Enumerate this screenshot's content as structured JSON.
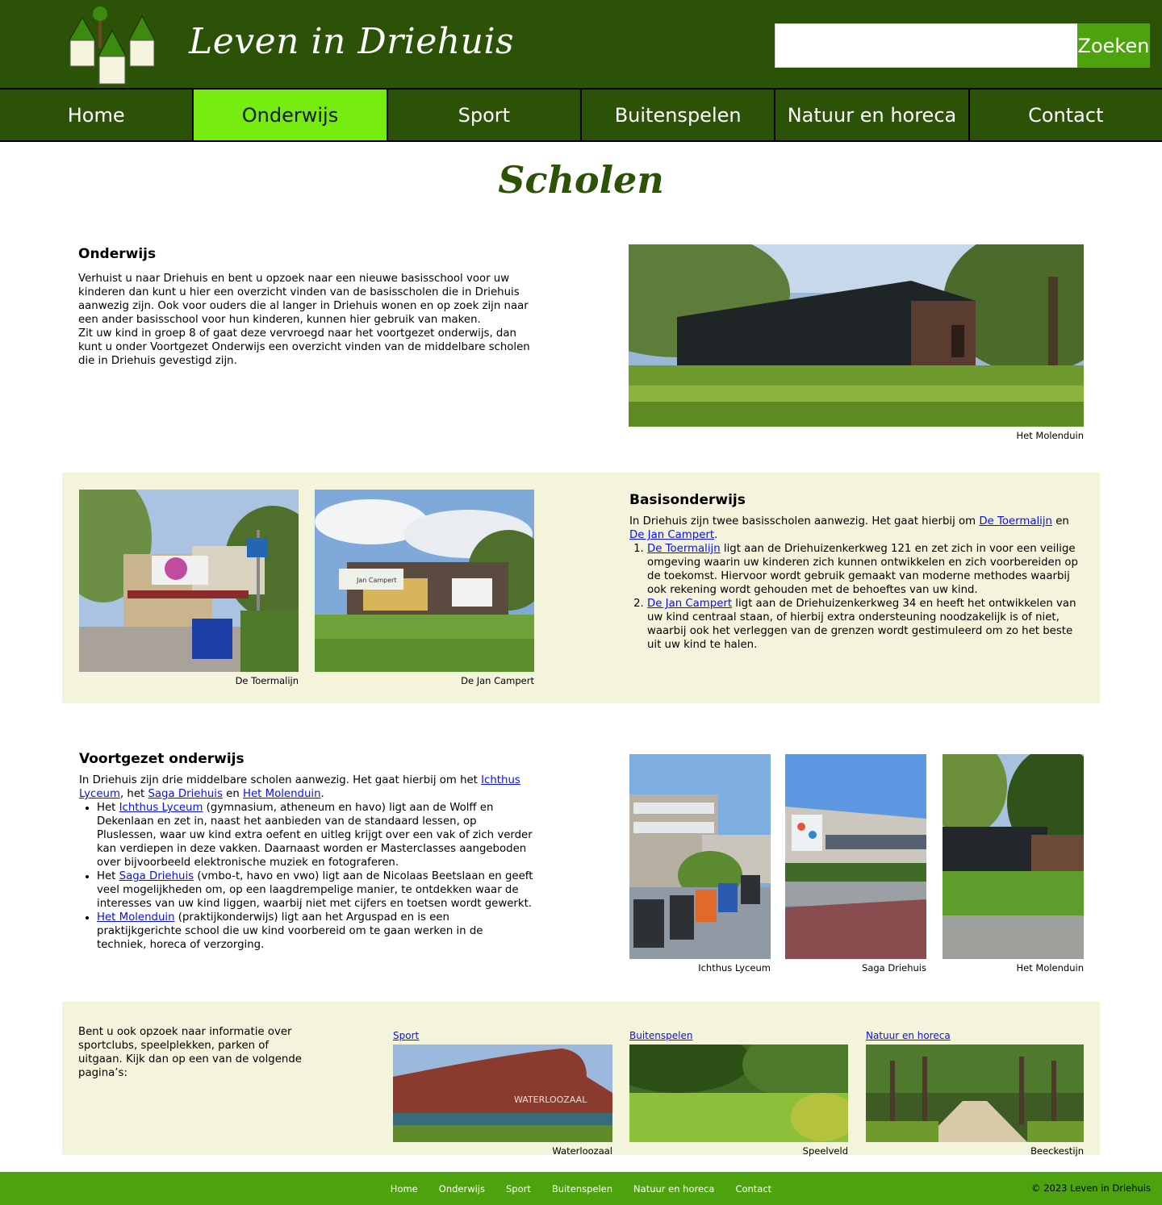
{
  "header": {
    "site_title": "Leven in Driehuis",
    "search_placeholder": "",
    "search_button": "Zoeken"
  },
  "nav": {
    "items": [
      {
        "label": "Home"
      },
      {
        "label": "Onderwijs",
        "active": true
      },
      {
        "label": "Sport"
      },
      {
        "label": "Buitenspelen"
      },
      {
        "label": "Natuur en horeca"
      },
      {
        "label": "Contact"
      }
    ]
  },
  "page": {
    "title": "Scholen"
  },
  "onderwijs": {
    "heading": "Onderwijs",
    "p1": "Verhuist u naar Driehuis en bent u opzoek naar een nieuwe basisschool voor uw kinderen dan kunt u hier een overzicht vinden van de basisscholen die in Driehuis aanwezig zijn. Ook voor ouders die al langer in Driehuis wonen en op zoek zijn naar een ander basisschool voor hun kinderen, kunnen hier gebruik van maken.",
    "p2": "Zit uw kind in groep 8 of gaat deze vervroegd naar het voortgezet onderwijs, dan kunt u onder Voortgezet Onderwijs een overzicht vinden van de middelbare scholen die in Driehuis gevestigd zijn.",
    "image_caption": "Het Molenduin"
  },
  "basis": {
    "heading": "Basisonderwijs",
    "intro_a": "In Driehuis zijn twee basisscholen aanwezig. Het gaat hierbij om ",
    "link1": "De Toermalijn",
    "intro_b": " en ",
    "link2": "De Jan Campert",
    "intro_c": ".",
    "items": [
      {
        "link": "De Toermalijn",
        "text": " ligt aan de Driehuizenkerkweg 121 en zet zich in voor een veilige omgeving waarin uw kinderen zich kunnen ontwikkelen en zich voorbereiden op de toekomst. Hiervoor wordt gebruik gemaakt van moderne methodes waarbij ook rekening wordt gehouden met de behoeftes van uw kind."
      },
      {
        "link": "De Jan Campert",
        "text": " ligt aan de Driehuizenkerkweg 34 en heeft het ontwikkelen van uw kind centraal staan, of hierbij extra ondersteuning noodzakelijk is of niet, waarbij ook het verleggen van de grenzen wordt gestimuleerd om zo het beste uit uw kind te halen."
      }
    ],
    "captions": [
      "De Toermalijn",
      "De Jan Campert"
    ],
    "sign_text": "Jan Campert"
  },
  "voortgezet": {
    "heading": "Voortgezet onderwijs",
    "intro_a": "In Driehuis zijn drie middelbare scholen aanwezig. Het gaat hierbij om het ",
    "link1": "Ichthus Lyceum",
    "intro_b": ", het ",
    "link2": "Saga Driehuis",
    "intro_c": " en ",
    "link3": "Het Molenduin",
    "intro_d": ".",
    "items": [
      {
        "pre": "Het ",
        "link": "Ichthus Lyceum",
        "text": " (gymnasium, atheneum en havo) ligt aan de Wolff en Dekenlaan en zet in, naast het aanbieden van de standaard lessen, op Pluslessen, waar uw kind extra oefent en uitleg krijgt over een vak of zich verder kan verdiepen in deze vakken. Daarnaast worden er Masterclasses aangeboden over bijvoorbeeld elektronische muziek en fotograferen."
      },
      {
        "pre": "Het ",
        "link": "Saga Driehuis",
        "text": " (vmbo-t, havo en vwo) ligt aan de Nicolaas Beetslaan en geeft veel mogelijkheden om, op een laagdrempelige manier, te ontdekken waar de interesses van uw kind liggen, waarbij niet met cijfers en toetsen wordt gewerkt."
      },
      {
        "pre": "",
        "link": "Het Molenduin",
        "text": " (praktijkonderwijs) ligt aan het Arguspad en is een praktijkgerichte school die uw kind voorbereid om te gaan werken in de techniek, horeca of verzorging."
      }
    ],
    "captions": [
      "Ichthus Lyceum",
      "Saga Driehuis",
      "Het Molenduin"
    ]
  },
  "more": {
    "text": "Bent u ook opzoek naar informatie over sportclubs, speelplekken, parken of uitgaan. Kijk dan op een van de volgende pagina’s:",
    "cards": [
      {
        "link": "Sport",
        "caption": "Waterloozaal"
      },
      {
        "link": "Buitenspelen",
        "caption": "Speelveld"
      },
      {
        "link": "Natuur en horeca",
        "caption": "Beeckestijn"
      }
    ],
    "building_sign": "WATERLOOZAAL"
  },
  "footer": {
    "links": [
      "Home",
      "Onderwijs",
      "Sport",
      "Buitenspelen",
      "Natuur en horeca",
      "Contact"
    ],
    "copyright": "© 2023 Leven in Driehuis"
  },
  "colors": {
    "header_bg": "#2c5208",
    "nav_active": "#76ec10",
    "accent_green": "#4da30e",
    "band_bg": "#f4f4dc",
    "link": "#0a10e6"
  }
}
